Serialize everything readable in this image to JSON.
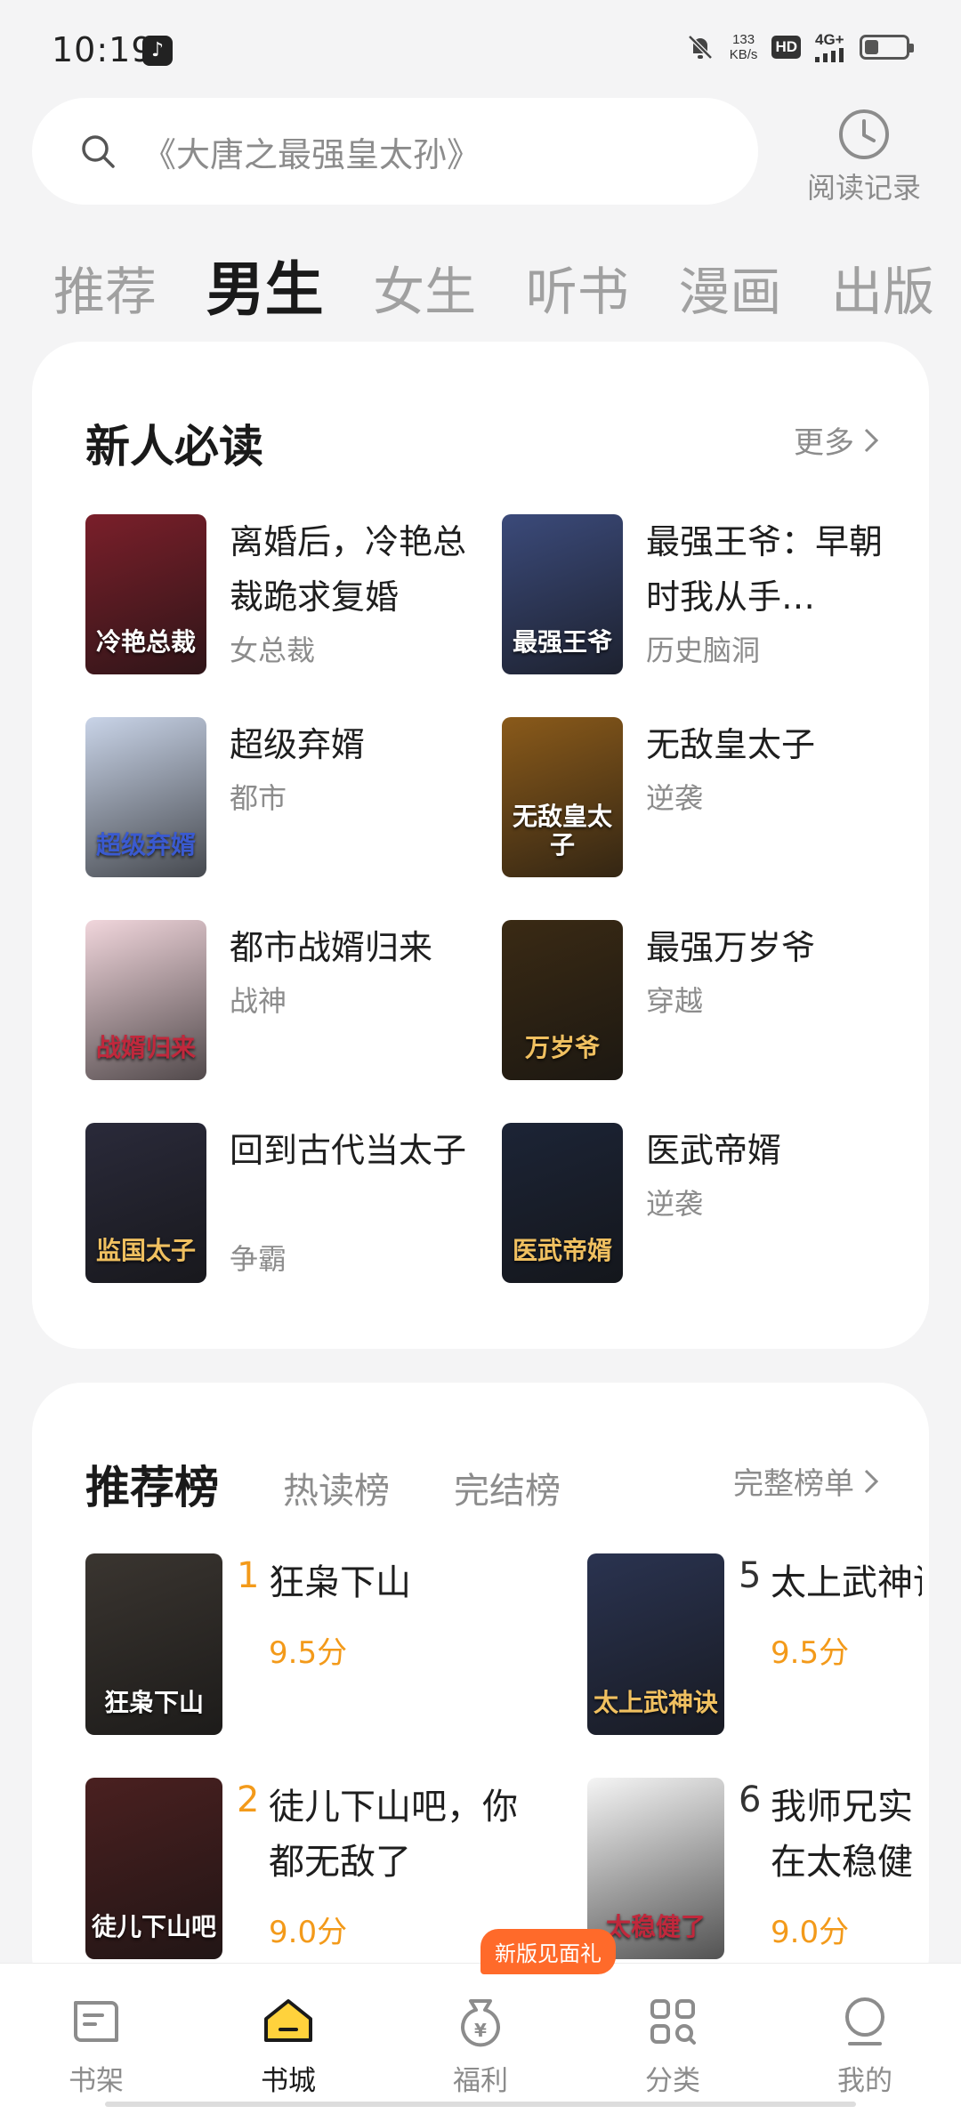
{
  "status_bar": {
    "time": "10:19",
    "network_speed_value": "133",
    "network_speed_unit": "KB/s",
    "hd": "HD",
    "network": "4G+",
    "battery_level": 0.35
  },
  "search": {
    "placeholder": "《大唐之最强皇太孙》"
  },
  "history": {
    "label": "阅读记录"
  },
  "tabs": [
    {
      "label": "推荐",
      "active": false
    },
    {
      "label": "男生",
      "active": true
    },
    {
      "label": "女生",
      "active": false
    },
    {
      "label": "听书",
      "active": false
    },
    {
      "label": "漫画",
      "active": false
    },
    {
      "label": "出版",
      "active": false
    }
  ],
  "section_new": {
    "title": "新人必读",
    "more": "更多",
    "books": [
      {
        "name": "离婚后，冷艳总裁跪求复婚",
        "tag": "女总裁",
        "cover_text": "冷艳总裁",
        "cover_color": "#7a1f2a"
      },
      {
        "name": "最强王爷：早朝时我从手…",
        "tag": "历史脑洞",
        "cover_text": "最强王爷",
        "cover_color": "#3b4a7a"
      },
      {
        "name": "超级弃婿",
        "tag": "都市",
        "cover_text": "超级弃婿",
        "cover_color": "#c9d4e8"
      },
      {
        "name": "无敌皇太子",
        "tag": "逆袭",
        "cover_text": "无敌皇太子",
        "cover_color": "#8a5a1a"
      },
      {
        "name": "都市战婿归来",
        "tag": "战神",
        "cover_text": "战婿归来",
        "cover_color": "#f1d6dc"
      },
      {
        "name": "最强万岁爷",
        "tag": "穿越",
        "cover_text": "万岁爷",
        "cover_color": "#3a2a14"
      },
      {
        "name": "回到古代当太子",
        "tag": "争霸",
        "cover_text": "监国太子",
        "cover_color": "#2a2a3a"
      },
      {
        "name": "医武帝婿",
        "tag": "逆袭",
        "cover_text": "医武帝婿",
        "cover_color": "#1c2436"
      }
    ]
  },
  "section_rank": {
    "tabs": [
      {
        "label": "推荐榜",
        "active": true
      },
      {
        "label": "热读榜",
        "active": false
      },
      {
        "label": "完结榜",
        "active": false
      }
    ],
    "more": "完整榜单",
    "books": [
      {
        "rank": "1",
        "name": "狂枭下山",
        "score": "9.5分",
        "cover_text": "狂枭下山",
        "cover_color": "#3a3530"
      },
      {
        "rank": "5",
        "name": "太上武神诀",
        "score": "9.5分",
        "cover_text": "太上武神诀",
        "cover_color": "#2a3350"
      },
      {
        "rank": "2",
        "name": "徒儿下山吧，你都无敌了",
        "score": "9.0分",
        "cover_text": "徒儿下山吧",
        "cover_color": "#4a2020"
      },
      {
        "rank": "6",
        "name": "我师兄实在太稳健了",
        "score": "9.0分",
        "cover_text": "太稳健了",
        "cover_color": "#f5f5f5"
      }
    ]
  },
  "nav": [
    {
      "label": "书架",
      "icon": "bookshelf-icon",
      "active": false
    },
    {
      "label": "书城",
      "icon": "bookstore-icon",
      "active": true
    },
    {
      "label": "福利",
      "icon": "welfare-icon",
      "active": false
    },
    {
      "label": "分类",
      "icon": "category-icon",
      "active": false
    },
    {
      "label": "我的",
      "icon": "profile-icon",
      "active": false
    }
  ],
  "promo_badge": "新版见面礼",
  "colors": {
    "accent": "#f39a1a",
    "highlight": "#ffd23c",
    "promo": "#ff6a2a"
  }
}
